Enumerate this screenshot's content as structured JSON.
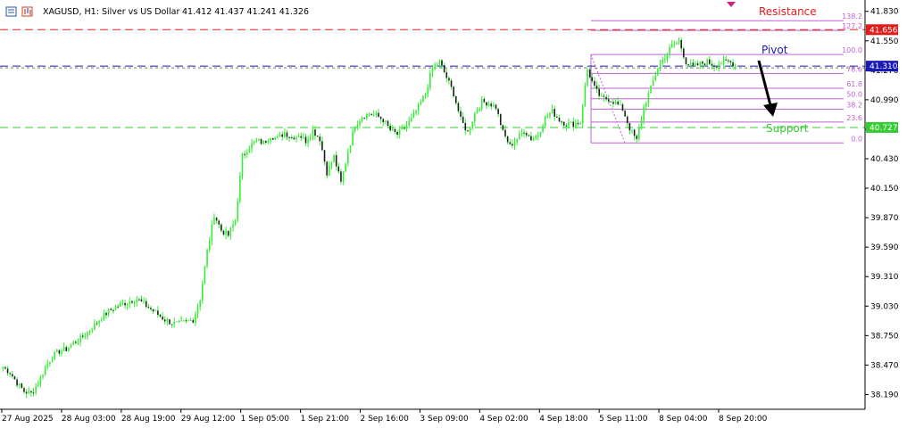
{
  "header": {
    "title": "XAGUSD, H1: Silver vs US Dollar",
    "ohlc": "41.412 41.437 41.241 41.326"
  },
  "chart_data": {
    "type": "candlestick",
    "symbol": "XAGUSD",
    "timeframe": "H1",
    "ylim": [
      38.05,
      41.87
    ],
    "y_ticks": [
      "41.830",
      "41.550",
      "41.270",
      "40.990",
      "40.710",
      "40.430",
      "40.150",
      "39.870",
      "39.590",
      "39.310",
      "39.030",
      "38.750",
      "38.470",
      "38.190"
    ],
    "x_ticks": [
      "27 Aug 2025",
      "28 Aug 03:00",
      "28 Aug 19:00",
      "29 Aug 12:00",
      "1 Sep 05:00",
      "1 Sep 21:00",
      "2 Sep 16:00",
      "3 Sep 09:00",
      "4 Sep 02:00",
      "4 Sep 18:00",
      "5 Sep 11:00",
      "8 Sep 04:00",
      "8 Sep 20:00"
    ],
    "close_path": [
      [
        0,
        38.45
      ],
      [
        3,
        38.4
      ],
      [
        6,
        38.3
      ],
      [
        9,
        38.22
      ],
      [
        12,
        38.2
      ],
      [
        15,
        38.3
      ],
      [
        18,
        38.45
      ],
      [
        21,
        38.55
      ],
      [
        24,
        38.6
      ],
      [
        27,
        38.62
      ],
      [
        30,
        38.68
      ],
      [
        33,
        38.72
      ],
      [
        36,
        38.78
      ],
      [
        39,
        38.85
      ],
      [
        42,
        38.92
      ],
      [
        45,
        38.98
      ],
      [
        48,
        39.02
      ],
      [
        51,
        39.05
      ],
      [
        54,
        39.08
      ],
      [
        57,
        39.1
      ],
      [
        60,
        39.05
      ],
      [
        63,
        39.0
      ],
      [
        66,
        38.95
      ],
      [
        69,
        38.9
      ],
      [
        72,
        38.87
      ],
      [
        75,
        38.86
      ],
      [
        78,
        38.88
      ],
      [
        81,
        38.9
      ],
      [
        84,
        39.1
      ],
      [
        87,
        39.55
      ],
      [
        90,
        39.9
      ],
      [
        93,
        39.75
      ],
      [
        96,
        39.7
      ],
      [
        99,
        39.85
      ],
      [
        102,
        40.45
      ],
      [
        105,
        40.55
      ],
      [
        108,
        40.6
      ],
      [
        111,
        40.58
      ],
      [
        114,
        40.65
      ],
      [
        117,
        40.62
      ],
      [
        120,
        40.68
      ],
      [
        123,
        40.63
      ],
      [
        126,
        40.66
      ],
      [
        129,
        40.6
      ],
      [
        132,
        40.7
      ],
      [
        135,
        40.62
      ],
      [
        138,
        40.3
      ],
      [
        141,
        40.45
      ],
      [
        144,
        40.2
      ],
      [
        147,
        40.5
      ],
      [
        150,
        40.75
      ],
      [
        153,
        40.83
      ],
      [
        156,
        40.86
      ],
      [
        159,
        40.84
      ],
      [
        162,
        40.8
      ],
      [
        165,
        40.7
      ],
      [
        168,
        40.66
      ],
      [
        171,
        40.72
      ],
      [
        174,
        40.8
      ],
      [
        177,
        40.92
      ],
      [
        180,
        41.05
      ],
      [
        183,
        41.3
      ],
      [
        186,
        41.35
      ],
      [
        189,
        41.2
      ],
      [
        192,
        41.05
      ],
      [
        195,
        40.8
      ],
      [
        198,
        40.68
      ],
      [
        201,
        40.86
      ],
      [
        204,
        40.97
      ],
      [
        207,
        40.96
      ],
      [
        210,
        40.92
      ],
      [
        213,
        40.68
      ],
      [
        216,
        40.55
      ],
      [
        219,
        40.62
      ],
      [
        222,
        40.7
      ],
      [
        225,
        40.62
      ],
      [
        228,
        40.66
      ],
      [
        231,
        40.82
      ],
      [
        234,
        40.88
      ],
      [
        237,
        40.8
      ],
      [
        240,
        40.76
      ],
      [
        243,
        40.76
      ],
      [
        246,
        40.78
      ],
      [
        249,
        41.28
      ],
      [
        252,
        41.1
      ],
      [
        255,
        41.0
      ],
      [
        258,
        41.0
      ],
      [
        261,
        40.96
      ],
      [
        264,
        40.9
      ],
      [
        267,
        40.72
      ],
      [
        270,
        40.6
      ],
      [
        273,
        40.92
      ],
      [
        276,
        41.1
      ],
      [
        279,
        41.3
      ],
      [
        282,
        41.4
      ],
      [
        285,
        41.5
      ],
      [
        288,
        41.55
      ],
      [
        291,
        41.35
      ],
      [
        294,
        41.3
      ],
      [
        297,
        41.33
      ],
      [
        300,
        41.35
      ],
      [
        303,
        41.32
      ],
      [
        306,
        41.34
      ],
      [
        309,
        41.35
      ],
      [
        312,
        41.326
      ]
    ],
    "fibonacci": {
      "levels": [
        "138.2",
        "127.2",
        "100.0",
        "78.6",
        "61.8",
        "50.0",
        "38.2",
        "23.6",
        "0.0"
      ],
      "low": 40.58,
      "high": 41.42
    },
    "horizontal_lines": [
      {
        "name": "resistance",
        "price": 41.656,
        "color": "#e41b1b"
      },
      {
        "name": "pivot",
        "price": 41.31,
        "color": "#1a1ab8"
      },
      {
        "name": "support",
        "price": 40.727,
        "color": "#33cc33"
      }
    ],
    "price_tags": [
      {
        "text": "41.656",
        "price": 41.656,
        "color": "#e41b1b"
      },
      {
        "text": "41.310",
        "price": 41.31,
        "color": "#1a1ab8"
      },
      {
        "text": "40.727",
        "price": 40.727,
        "color": "#33cc33"
      }
    ],
    "annotations": {
      "resistance": "Resistance",
      "pivot": "Pivot",
      "support": "Support"
    },
    "colors": {
      "candle": "#33ee33",
      "fib": "#c060d8",
      "grid": "none",
      "bg": "#ffffff"
    }
  }
}
